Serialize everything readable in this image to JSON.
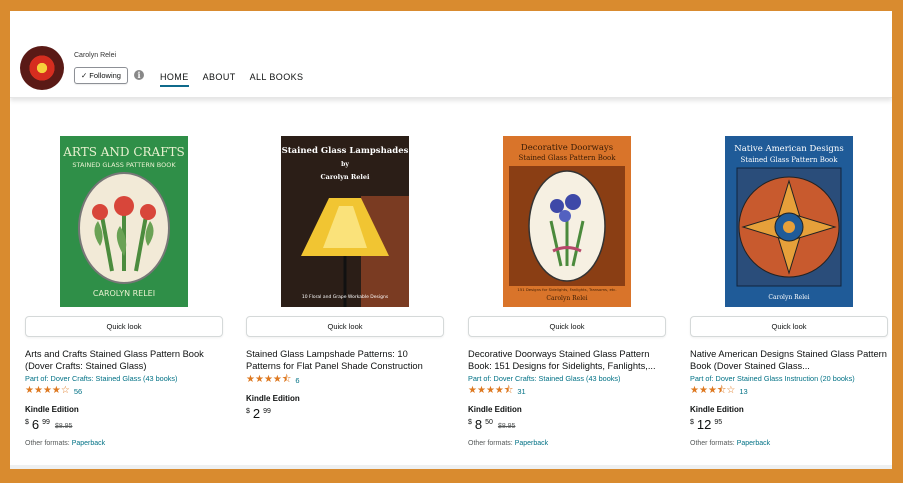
{
  "author": {
    "name": "Carolyn Relei",
    "follow_label": "Following",
    "follow_check": "✓",
    "info_glyph": "i"
  },
  "nav": {
    "items": [
      {
        "label": "HOME",
        "active": true
      },
      {
        "label": "ABOUT",
        "active": false
      },
      {
        "label": "ALL BOOKS",
        "active": false
      }
    ]
  },
  "quick_look_label": "Quick look",
  "books": [
    {
      "cover": {
        "line1": "ARTS AND CRAFTS",
        "line2": "STAINED GLASS PATTERN BOOK",
        "author": "CAROLYN RELEI"
      },
      "title": "Arts and Crafts Stained Glass Pattern Book (Dover Crafts: Stained Glass)",
      "series": "Part of: Dover Crafts: Stained Glass (43 books)",
      "stars": 4,
      "rating_count": "56",
      "format": "Kindle Edition",
      "price_sym": "$",
      "price_whole": "6",
      "price_frac": "99",
      "list_price": "$8.95",
      "other_prefix": "Other formats:",
      "other_link": "Paperback"
    },
    {
      "cover": {
        "line1": "Stained Glass Lampshades",
        "line2": "by",
        "author": "Carolyn Relei",
        "footer": "10 Floral and Grape Workable Designs"
      },
      "title": "Stained Glass Lampshade Patterns: 10 Patterns for Flat Panel Shade Construction",
      "series": "",
      "stars": 4.5,
      "rating_count": "6",
      "format": "Kindle Edition",
      "price_sym": "$",
      "price_whole": "2",
      "price_frac": "99",
      "list_price": "",
      "other_prefix": "",
      "other_link": ""
    },
    {
      "cover": {
        "line1": "Decorative Doorways",
        "line2": "Stained Glass Pattern Book",
        "footer": "151 Designs for Sidelights, Fanlights, Transoms, etc.",
        "author": "Carolyn Relei"
      },
      "title": "Decorative Doorways Stained Glass Pattern Book: 151 Designs for Sidelights, Fanlights,...",
      "series": "Part of: Dover Crafts: Stained Glass (43 books)",
      "stars": 4.5,
      "rating_count": "31",
      "format": "Kindle Edition",
      "price_sym": "$",
      "price_whole": "8",
      "price_frac": "50",
      "list_price": "$8.95",
      "other_prefix": "Other formats:",
      "other_link": "Paperback"
    },
    {
      "cover": {
        "line1": "Native American Designs",
        "line2": "Stained Glass Pattern Book",
        "author": "Carolyn Relei"
      },
      "title": "Native American Designs Stained Glass Pattern Book (Dover Stained Glass...",
      "series": "Part of: Dover Stained Glass Instruction (20 books)",
      "stars": 3.5,
      "rating_count": "13",
      "format": "Kindle Edition",
      "price_sym": "$",
      "price_whole": "12",
      "price_frac": "95",
      "list_price": "",
      "other_prefix": "Other formats:",
      "other_link": "Paperback"
    }
  ],
  "colors": {
    "page_border": "#d98b2f",
    "link": "#007185",
    "star": "#de7921",
    "nav_underline": "#0f6a8b"
  }
}
